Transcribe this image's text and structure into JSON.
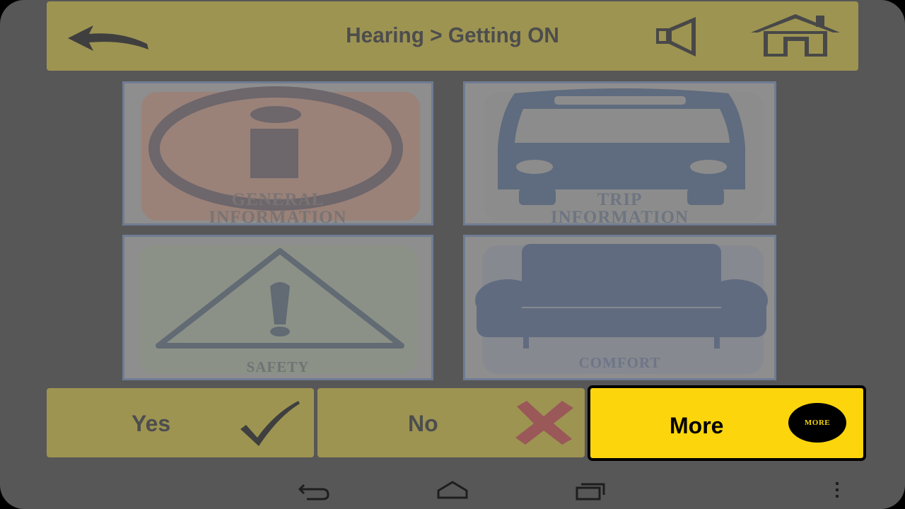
{
  "header": {
    "breadcrumb": "Hearing > Getting ON",
    "back_icon": "back-arrow-icon",
    "sound_icon": "speaker-icon",
    "home_icon": "home-icon"
  },
  "tiles": [
    {
      "label_line1": "GENERAL",
      "label_line2": "INFORMATION",
      "icon": "info-icon"
    },
    {
      "label_line1": "TRIP",
      "label_line2": "INFORMATION",
      "icon": "bus-icon"
    },
    {
      "label": "SAFETY",
      "icon": "warning-icon"
    },
    {
      "label": "COMFORT",
      "icon": "seat-icon"
    }
  ],
  "actions": {
    "yes_label": "Yes",
    "no_label": "No",
    "more_label": "More",
    "more_badge": "MORE"
  },
  "system_nav": {
    "back_icon": "nav-back-icon",
    "home_icon": "nav-home-icon",
    "recents_icon": "nav-recents-icon",
    "menu_icon": "overflow-menu-icon"
  },
  "colors": {
    "bar": "#9d9452",
    "more_button": "#fcd50c",
    "background": "#575757"
  }
}
